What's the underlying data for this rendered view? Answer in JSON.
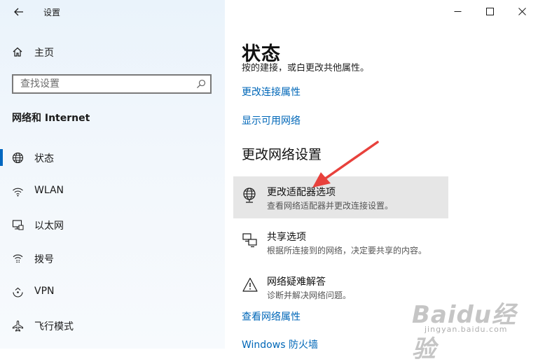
{
  "window": {
    "title": "设置"
  },
  "nav": {
    "home_label": "主页",
    "search_placeholder": "查找设置",
    "section_title": "网络和 Internet",
    "items": [
      {
        "label": "状态",
        "icon": "globe-icon",
        "active": true
      },
      {
        "label": "WLAN",
        "icon": "wifi-icon",
        "active": false
      },
      {
        "label": "以太网",
        "icon": "ethernet-icon",
        "active": false
      },
      {
        "label": "拨号",
        "icon": "dialup-icon",
        "active": false
      },
      {
        "label": "VPN",
        "icon": "vpn-icon",
        "active": false
      },
      {
        "label": "飞行模式",
        "icon": "airplane-icon",
        "active": false
      }
    ]
  },
  "main": {
    "title": "状态",
    "clipped_text": "按的建接，或白更改共他属性。",
    "links_top": [
      "更改连接属性",
      "显示可用网络"
    ],
    "subheading": "更改网络设置",
    "options": [
      {
        "title": "更改适配器选项",
        "desc": "查看网络适配器并更改连接设置。",
        "icon": "adapter-globe-icon"
      },
      {
        "title": "共享选项",
        "desc": "根据所连接到的网络，决定要共享的内容。",
        "icon": "sharing-icon"
      },
      {
        "title": "网络疑难解答",
        "desc": "诊断并解决网络问题。",
        "icon": "warning-icon"
      }
    ],
    "links_bottom": [
      "查看网络属性",
      "Windows 防火墙"
    ]
  },
  "watermark": {
    "brand": "Baidu经验",
    "url": "jingyan.baidu.com"
  },
  "colors": {
    "accent": "#0067c0",
    "link": "#0067b8",
    "arrow": "#e8413c"
  }
}
